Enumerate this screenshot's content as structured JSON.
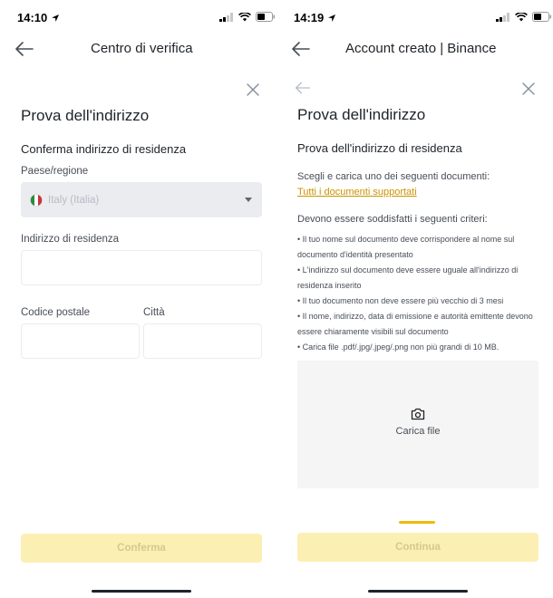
{
  "left": {
    "status_time": "14:10",
    "nav_title": "Centro di verifica",
    "heading": "Prova dell'indirizzo",
    "subheading": "Conferma indirizzo di residenza",
    "country_label": "Paese/regione",
    "country_value": "Italy (Italia)",
    "address_label": "Indirizzo di residenza",
    "postal_label": "Codice postale",
    "city_label": "Città",
    "confirm_button": "Conferma"
  },
  "right": {
    "status_time": "14:19",
    "nav_title": "Account creato | Binance",
    "heading": "Prova dell'indirizzo",
    "subheading": "Prova dell'indirizzo di residenza",
    "instruction": "Scegli e carica uno dei seguenti documenti:",
    "supported_link": "Tutti i documenti supportati",
    "criteria_title": "Devono essere soddisfatti i seguenti criteri:",
    "criteria": [
      "• Il tuo nome sul documento deve corrispondere al nome sul documento d'identità presentato",
      "• L'indirizzo sul documento deve essere uguale all'indirizzo di residenza inserito",
      "• Il tuo documento non deve essere più vecchio di 3 mesi",
      "• Il nome, indirizzo, data di emissione e autorità emittente devono essere chiaramente visibili sul documento",
      "• Carica file .pdf/.jpg/.jpeg/.png non più grandi di 10 MB."
    ],
    "upload_label": "Carica file",
    "continue_button": "Continua"
  },
  "colors": {
    "accent": "#f0b90b",
    "button_disabled_bg": "#fcefb4",
    "button_disabled_text": "#d5c98c",
    "link": "#c99400",
    "select_bg": "#eaecef"
  },
  "icons": [
    "location-arrow-icon",
    "signal-icon",
    "wifi-icon",
    "battery-icon",
    "back-arrow-icon",
    "close-icon",
    "flag-italy-icon",
    "dropdown-caret-icon",
    "camera-icon"
  ]
}
